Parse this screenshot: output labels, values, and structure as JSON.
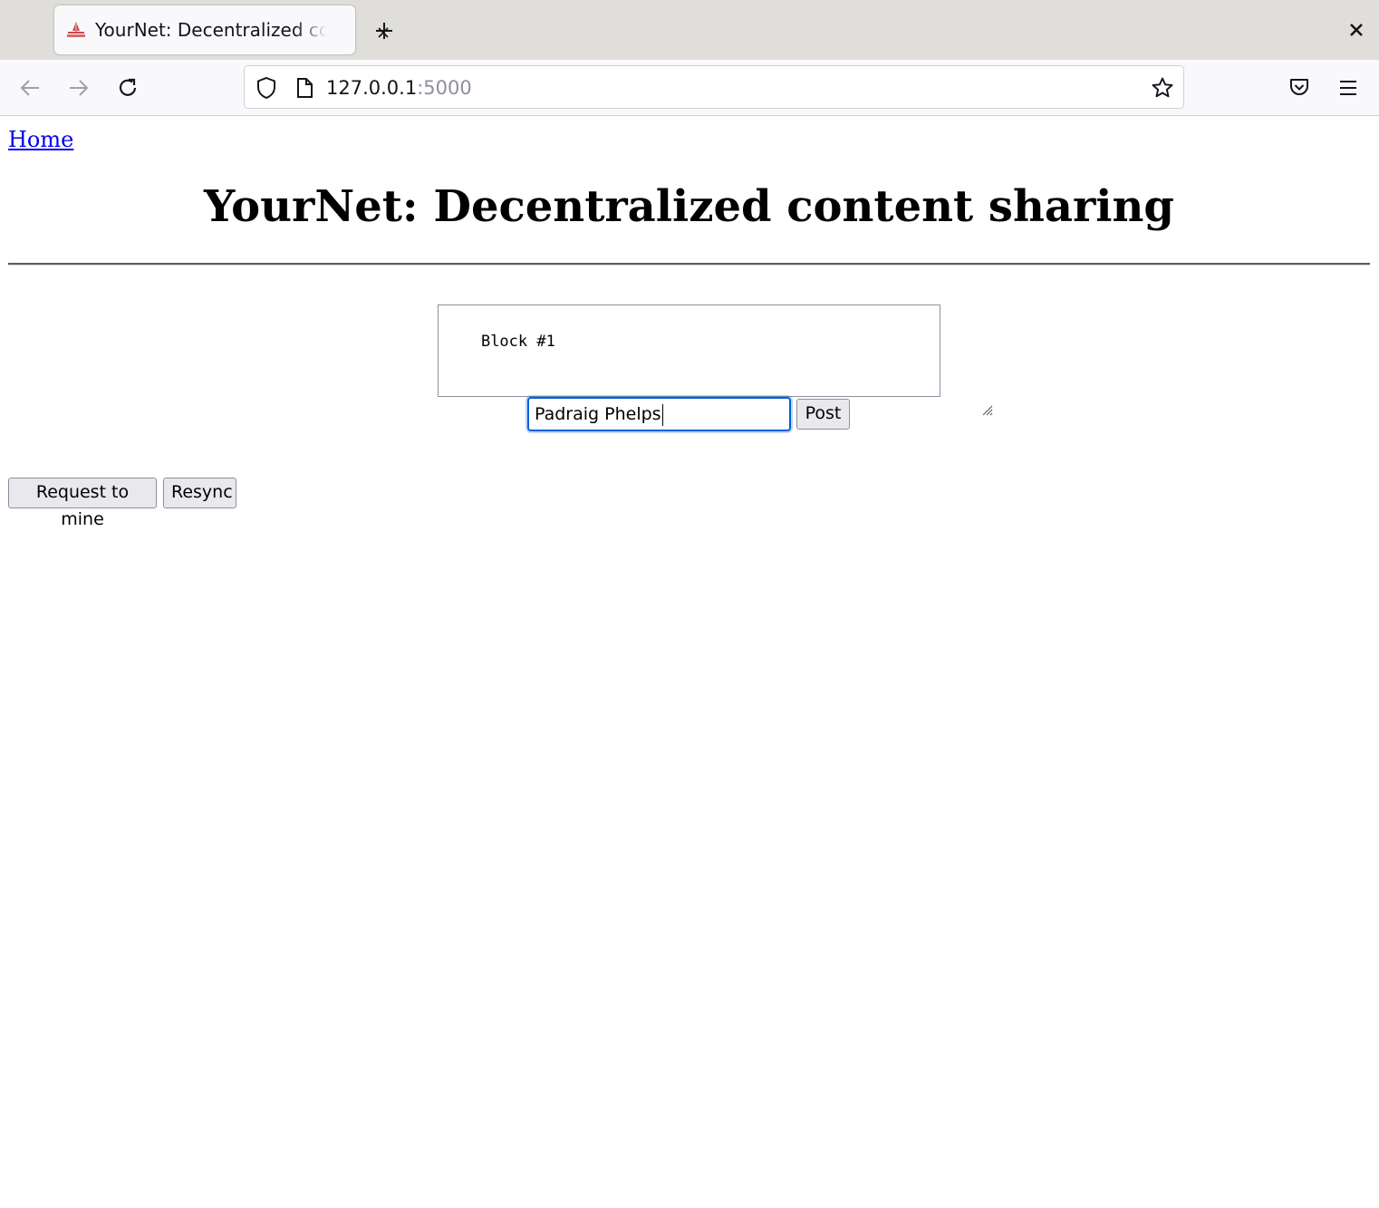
{
  "browser": {
    "tab": {
      "title": "YourNet: Decentralized content sharing",
      "favicon": "yournet-favicon-icon",
      "close_icon": "close-icon"
    },
    "new_tab_icon": "plus-icon",
    "window_close_icon": "close-icon",
    "nav": {
      "back_icon": "arrow-left-icon",
      "forward_icon": "arrow-right-icon",
      "reload_icon": "reload-icon"
    },
    "url": {
      "host": "127.0.0.1",
      "port": ":5000",
      "shield_icon": "shield-icon",
      "page_icon": "page-icon",
      "bookmark_icon": "star-icon"
    },
    "pocket_icon": "pocket-icon",
    "menu_icon": "hamburger-menu-icon"
  },
  "page": {
    "home_link": "Home",
    "heading": "YourNet: Decentralized content sharing",
    "post_form": {
      "content_value": "Block #1",
      "author_value": "Padraig Phelps",
      "post_label": "Post"
    },
    "actions": {
      "mine_label": "Request to mine",
      "resync_label": "Resync"
    }
  },
  "colors": {
    "link": "#0000ee",
    "focus_ring": "#0060df",
    "tabbar_bg": "#e0dedb",
    "toolbar_bg": "#f9f9fb",
    "button_bg": "#e9e9ed"
  }
}
